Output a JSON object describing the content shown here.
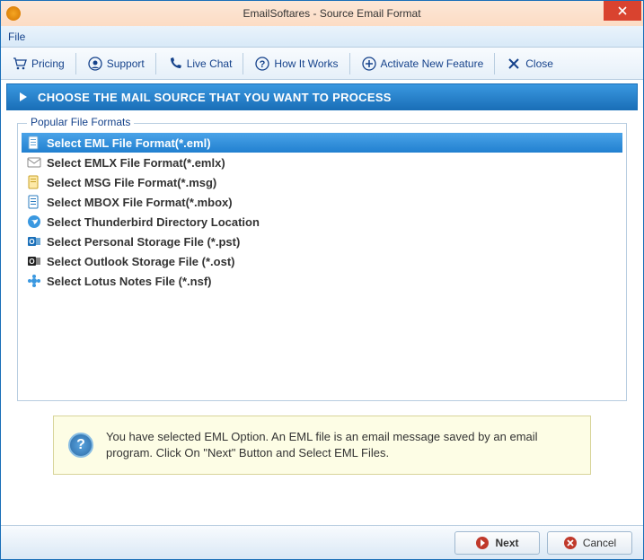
{
  "window": {
    "title": "EmailSoftares - Source Email Format"
  },
  "menubar": {
    "file": "File"
  },
  "toolbar": {
    "pricing": "Pricing",
    "support": "Support",
    "live_chat": "Live Chat",
    "how_it_works": "How It Works",
    "activate": "Activate New Feature",
    "close": "Close"
  },
  "band": {
    "title": "CHOOSE THE MAIL SOURCE THAT YOU WANT TO PROCESS"
  },
  "formats": {
    "legend": "Popular File Formats",
    "items": [
      {
        "label": "Select EML File Format(*.eml)",
        "selected": true,
        "icon": "file-eml"
      },
      {
        "label": "Select EMLX File Format(*.emlx)",
        "selected": false,
        "icon": "envelope"
      },
      {
        "label": "Select MSG File Format(*.msg)",
        "selected": false,
        "icon": "file-msg"
      },
      {
        "label": "Select MBOX File Format(*.mbox)",
        "selected": false,
        "icon": "file-mbox"
      },
      {
        "label": "Select Thunderbird Directory Location",
        "selected": false,
        "icon": "thunderbird"
      },
      {
        "label": "Select Personal Storage File (*.pst)",
        "selected": false,
        "icon": "outlook"
      },
      {
        "label": "Select Outlook Storage File (*.ost)",
        "selected": false,
        "icon": "outlook-dark"
      },
      {
        "label": "Select Lotus Notes File (*.nsf)",
        "selected": false,
        "icon": "lotus"
      }
    ]
  },
  "info": {
    "text": "You have selected EML Option. An EML file is an email message saved by an email program. Click On \"Next\" Button and Select EML Files."
  },
  "footer": {
    "next": "Next",
    "cancel": "Cancel"
  }
}
